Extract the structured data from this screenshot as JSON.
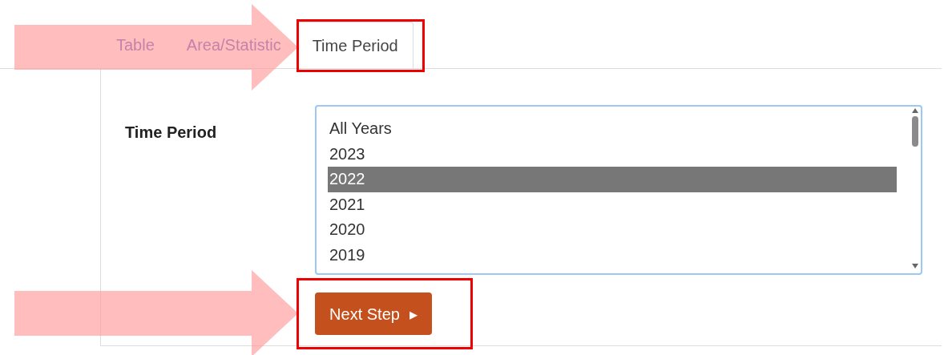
{
  "tabs": [
    {
      "label": "Table",
      "selected": false
    },
    {
      "label": "Area/Statistic",
      "selected": false
    },
    {
      "label": "Time Period",
      "selected": true
    }
  ],
  "field": {
    "label": "Time Period",
    "options": [
      {
        "label": "All Years",
        "selected": false
      },
      {
        "label": "2023",
        "selected": false
      },
      {
        "label": "2022",
        "selected": true
      },
      {
        "label": "2021",
        "selected": false
      },
      {
        "label": "2020",
        "selected": false
      },
      {
        "label": "2019",
        "selected": false
      }
    ]
  },
  "button": {
    "label": "Next Step",
    "icon": "▸"
  }
}
